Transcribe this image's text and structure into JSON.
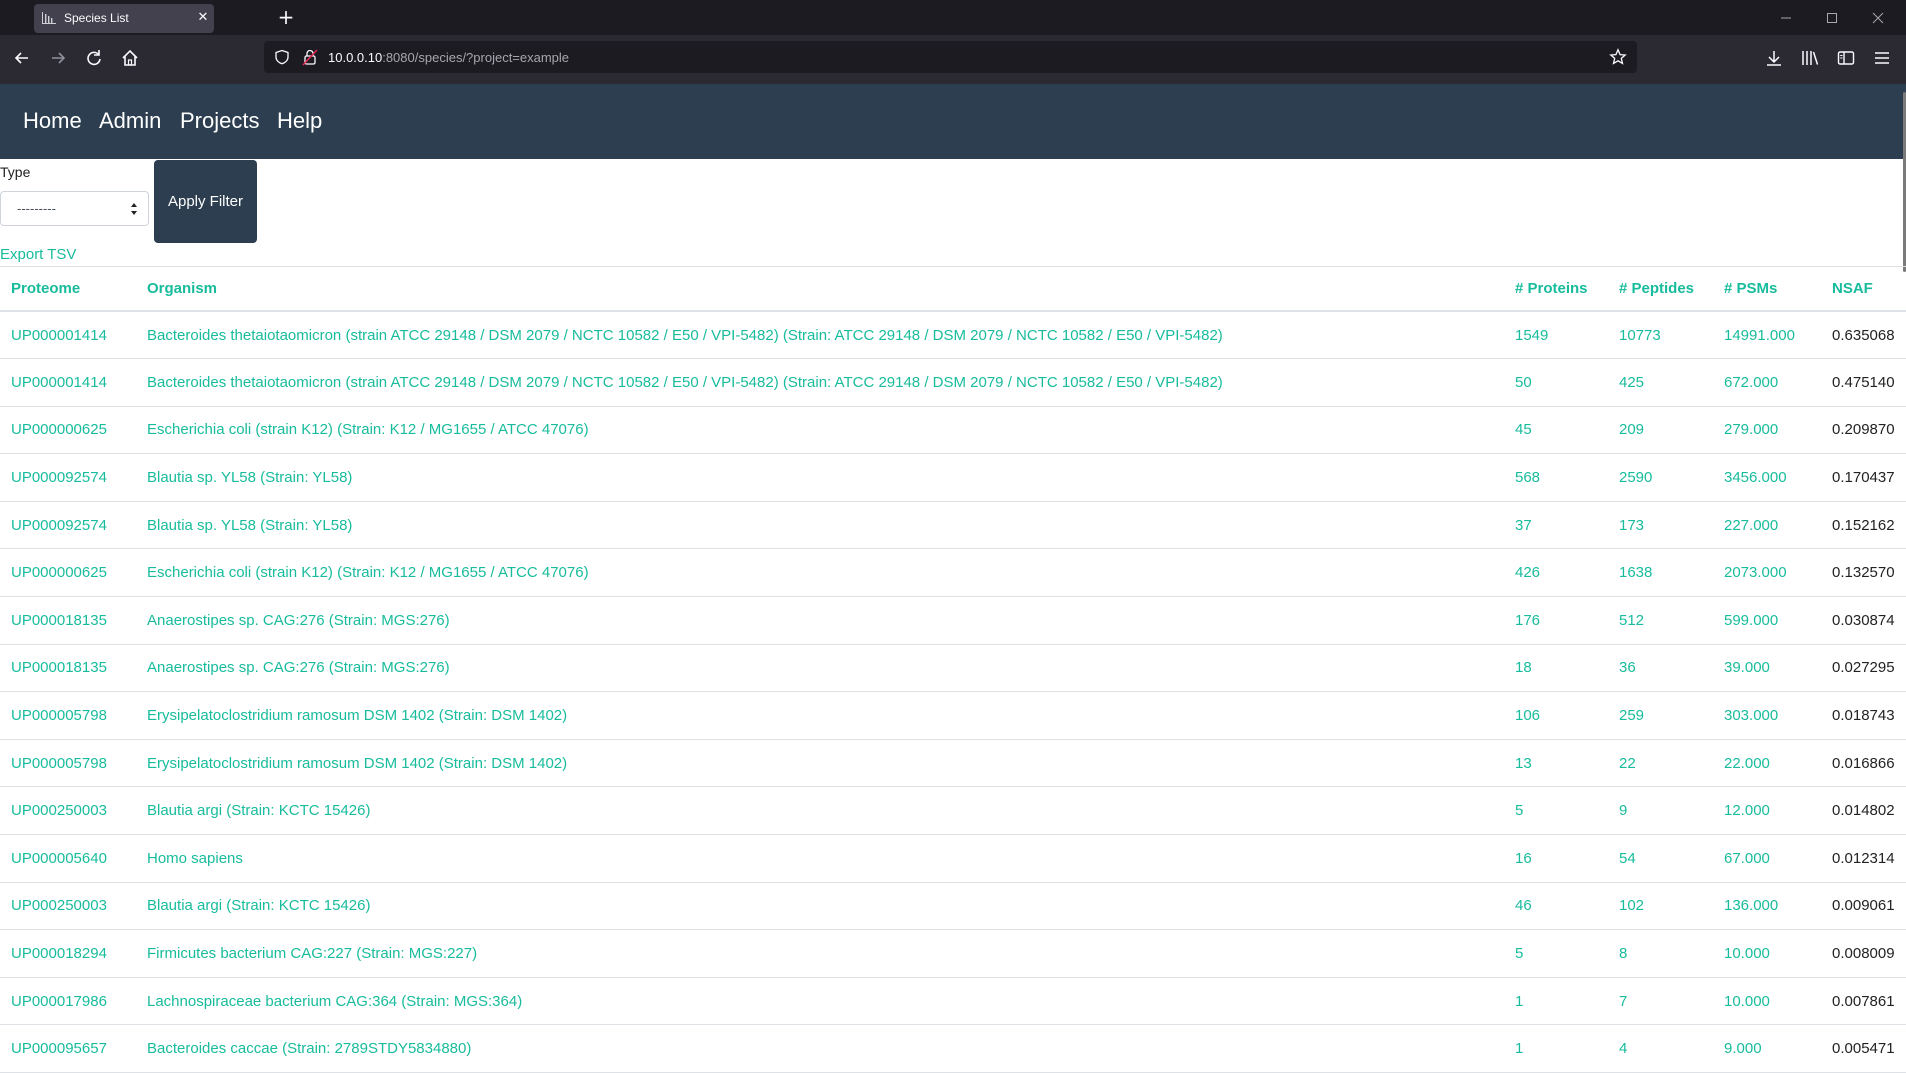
{
  "browser": {
    "tab_title": "Species List",
    "url_host": "10.0.0.10",
    "url_rest": ":8080/species/?project=example"
  },
  "navbar": {
    "items": [
      {
        "label": "Home"
      },
      {
        "label": "Admin"
      },
      {
        "label": "Projects"
      },
      {
        "label": "Help"
      }
    ]
  },
  "filter": {
    "type_label": "Type",
    "type_selected": "---------",
    "apply_label": "Apply Filter"
  },
  "export_label": "Export TSV",
  "table": {
    "headers": {
      "proteome": "Proteome",
      "organism": "Organism",
      "proteins": "# Proteins",
      "peptides": "# Peptides",
      "psms": "# PSMs",
      "nsaf": "NSAF"
    },
    "rows": [
      {
        "proteome": "UP000001414",
        "organism": "Bacteroides thetaiotaomicron (strain ATCC 29148 / DSM 2079 / NCTC 10582 / E50 / VPI-5482) (Strain: ATCC 29148 / DSM 2079 / NCTC 10582 / E50 / VPI-5482)",
        "proteins": "1549",
        "peptides": "10773",
        "psms": "14991.000",
        "nsaf": "0.635068"
      },
      {
        "proteome": "UP000001414",
        "organism": "Bacteroides thetaiotaomicron (strain ATCC 29148 / DSM 2079 / NCTC 10582 / E50 / VPI-5482) (Strain: ATCC 29148 / DSM 2079 / NCTC 10582 / E50 / VPI-5482)",
        "proteins": "50",
        "peptides": "425",
        "psms": "672.000",
        "nsaf": "0.475140"
      },
      {
        "proteome": "UP000000625",
        "organism": "Escherichia coli (strain K12) (Strain: K12 / MG1655 / ATCC 47076)",
        "proteins": "45",
        "peptides": "209",
        "psms": "279.000",
        "nsaf": "0.209870"
      },
      {
        "proteome": "UP000092574",
        "organism": "Blautia sp. YL58 (Strain: YL58)",
        "proteins": "568",
        "peptides": "2590",
        "psms": "3456.000",
        "nsaf": "0.170437"
      },
      {
        "proteome": "UP000092574",
        "organism": "Blautia sp. YL58 (Strain: YL58)",
        "proteins": "37",
        "peptides": "173",
        "psms": "227.000",
        "nsaf": "0.152162"
      },
      {
        "proteome": "UP000000625",
        "organism": "Escherichia coli (strain K12) (Strain: K12 / MG1655 / ATCC 47076)",
        "proteins": "426",
        "peptides": "1638",
        "psms": "2073.000",
        "nsaf": "0.132570"
      },
      {
        "proteome": "UP000018135",
        "organism": "Anaerostipes sp. CAG:276 (Strain: MGS:276)",
        "proteins": "176",
        "peptides": "512",
        "psms": "599.000",
        "nsaf": "0.030874"
      },
      {
        "proteome": "UP000018135",
        "organism": "Anaerostipes sp. CAG:276 (Strain: MGS:276)",
        "proteins": "18",
        "peptides": "36",
        "psms": "39.000",
        "nsaf": "0.027295"
      },
      {
        "proteome": "UP000005798",
        "organism": "Erysipelatoclostridium ramosum DSM 1402 (Strain: DSM 1402)",
        "proteins": "106",
        "peptides": "259",
        "psms": "303.000",
        "nsaf": "0.018743"
      },
      {
        "proteome": "UP000005798",
        "organism": "Erysipelatoclostridium ramosum DSM 1402 (Strain: DSM 1402)",
        "proteins": "13",
        "peptides": "22",
        "psms": "22.000",
        "nsaf": "0.016866"
      },
      {
        "proteome": "UP000250003",
        "organism": "Blautia argi (Strain: KCTC 15426)",
        "proteins": "5",
        "peptides": "9",
        "psms": "12.000",
        "nsaf": "0.014802"
      },
      {
        "proteome": "UP000005640",
        "organism": "Homo sapiens",
        "proteins": "16",
        "peptides": "54",
        "psms": "67.000",
        "nsaf": "0.012314"
      },
      {
        "proteome": "UP000250003",
        "organism": "Blautia argi (Strain: KCTC 15426)",
        "proteins": "46",
        "peptides": "102",
        "psms": "136.000",
        "nsaf": "0.009061"
      },
      {
        "proteome": "UP000018294",
        "organism": "Firmicutes bacterium CAG:227 (Strain: MGS:227)",
        "proteins": "5",
        "peptides": "8",
        "psms": "10.000",
        "nsaf": "0.008009"
      },
      {
        "proteome": "UP000017986",
        "organism": "Lachnospiraceae bacterium CAG:364 (Strain: MGS:364)",
        "proteins": "1",
        "peptides": "7",
        "psms": "10.000",
        "nsaf": "0.007861"
      },
      {
        "proteome": "UP000095657",
        "organism": "Bacteroides caccae (Strain: 2789STDY5834880)",
        "proteins": "1",
        "peptides": "4",
        "psms": "9.000",
        "nsaf": "0.005471"
      }
    ]
  },
  "colors": {
    "navbar_bg": "#2c3e50",
    "link": "#18bc9c",
    "chrome_dark": "#1c1b22",
    "chrome_toolbar": "#2b2a33"
  }
}
